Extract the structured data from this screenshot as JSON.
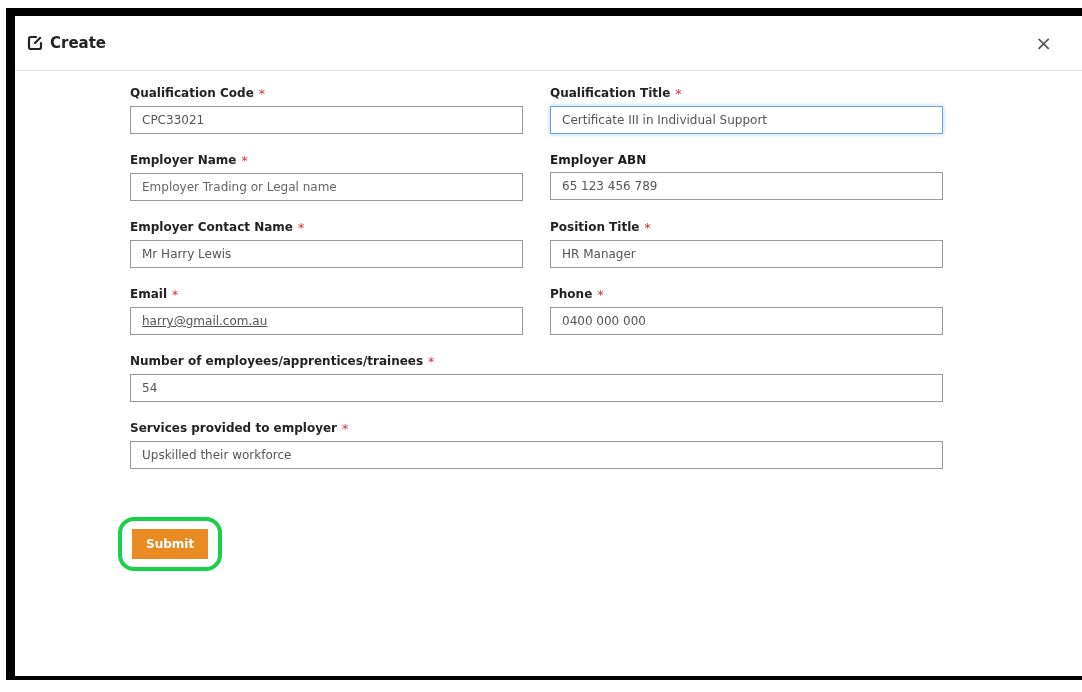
{
  "dialog": {
    "title": "Create",
    "close": "×"
  },
  "fields": [
    {
      "label": "Qualification Code",
      "required": true,
      "kind": "half",
      "value": "CPC33021",
      "focused": false
    },
    {
      "label": "Qualification Title",
      "required": true,
      "kind": "half",
      "value": "Certificate III in Individual Support",
      "focused": true
    },
    {
      "label": "Employer Name",
      "required": true,
      "kind": "half",
      "placeholder": "Employer Trading or Legal name",
      "focused": false
    },
    {
      "label": "Employer ABN",
      "required": false,
      "kind": "half",
      "value": "65 123 456 789",
      "focused": false
    },
    {
      "label": "Employer Contact Name",
      "required": true,
      "kind": "half",
      "value": "Mr Harry Lewis",
      "focused": false
    },
    {
      "label": "Position Title",
      "required": true,
      "kind": "half",
      "value": "HR Manager",
      "focused": false
    },
    {
      "label": "Email",
      "required": true,
      "kind": "half",
      "value": "harry@gmail.com.au",
      "underlined": true,
      "focused": false
    },
    {
      "label": "Phone",
      "required": true,
      "kind": "half",
      "value": "0400 000 000",
      "focused": false
    },
    {
      "label": "Number of employees/apprentices/trainees",
      "required": true,
      "kind": "wide",
      "value": "54",
      "focused": false
    },
    {
      "label": "Services provided to employer",
      "required": true,
      "kind": "wide",
      "value": "Upskilled their workforce",
      "focused": false
    }
  ],
  "required_mark": "*",
  "submit": {
    "label": "Submit",
    "highlighted": true
  }
}
